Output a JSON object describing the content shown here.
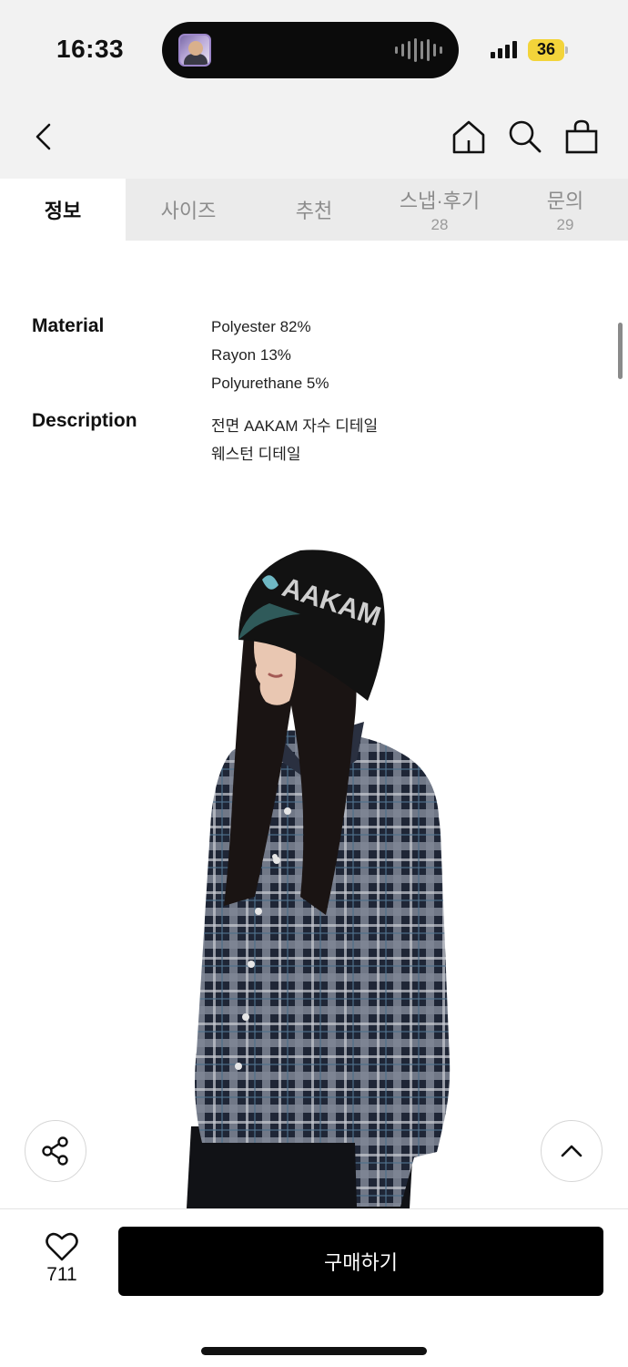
{
  "status_bar": {
    "time": "16:33",
    "battery": "36",
    "battery_color": "#f3d43a"
  },
  "header": {
    "back_icon": "chevron-left-icon",
    "home_icon": "home-icon",
    "search_icon": "search-icon",
    "cart_icon": "shopping-bag-icon"
  },
  "tabs": [
    {
      "label": "정보",
      "count": "",
      "active": true
    },
    {
      "label": "사이즈",
      "count": "",
      "active": false
    },
    {
      "label": "추천",
      "count": "",
      "active": false
    },
    {
      "label": "스냅·후기",
      "count": "28",
      "active": false
    },
    {
      "label": "문의",
      "count": "29",
      "active": false
    }
  ],
  "info": {
    "material_label": "Material",
    "material_values": [
      "Polyester 82%",
      "Rayon 13%",
      "Polyurethane 5%"
    ],
    "description_label": "Description",
    "description_values": [
      "전면 AAKAM 자수 디테일",
      "웨스턴 디테일"
    ]
  },
  "product_image": {
    "hat_text": "AAKAM",
    "alt": "Model wearing black AAKAM bucket hat and navy plaid western shirt"
  },
  "floating": {
    "share_icon": "share-icon",
    "scroll_top_icon": "chevron-up-icon"
  },
  "bottom_bar": {
    "like_icon": "heart-icon",
    "like_count": "711",
    "buy_label": "구매하기",
    "buy_color": "#000000"
  }
}
